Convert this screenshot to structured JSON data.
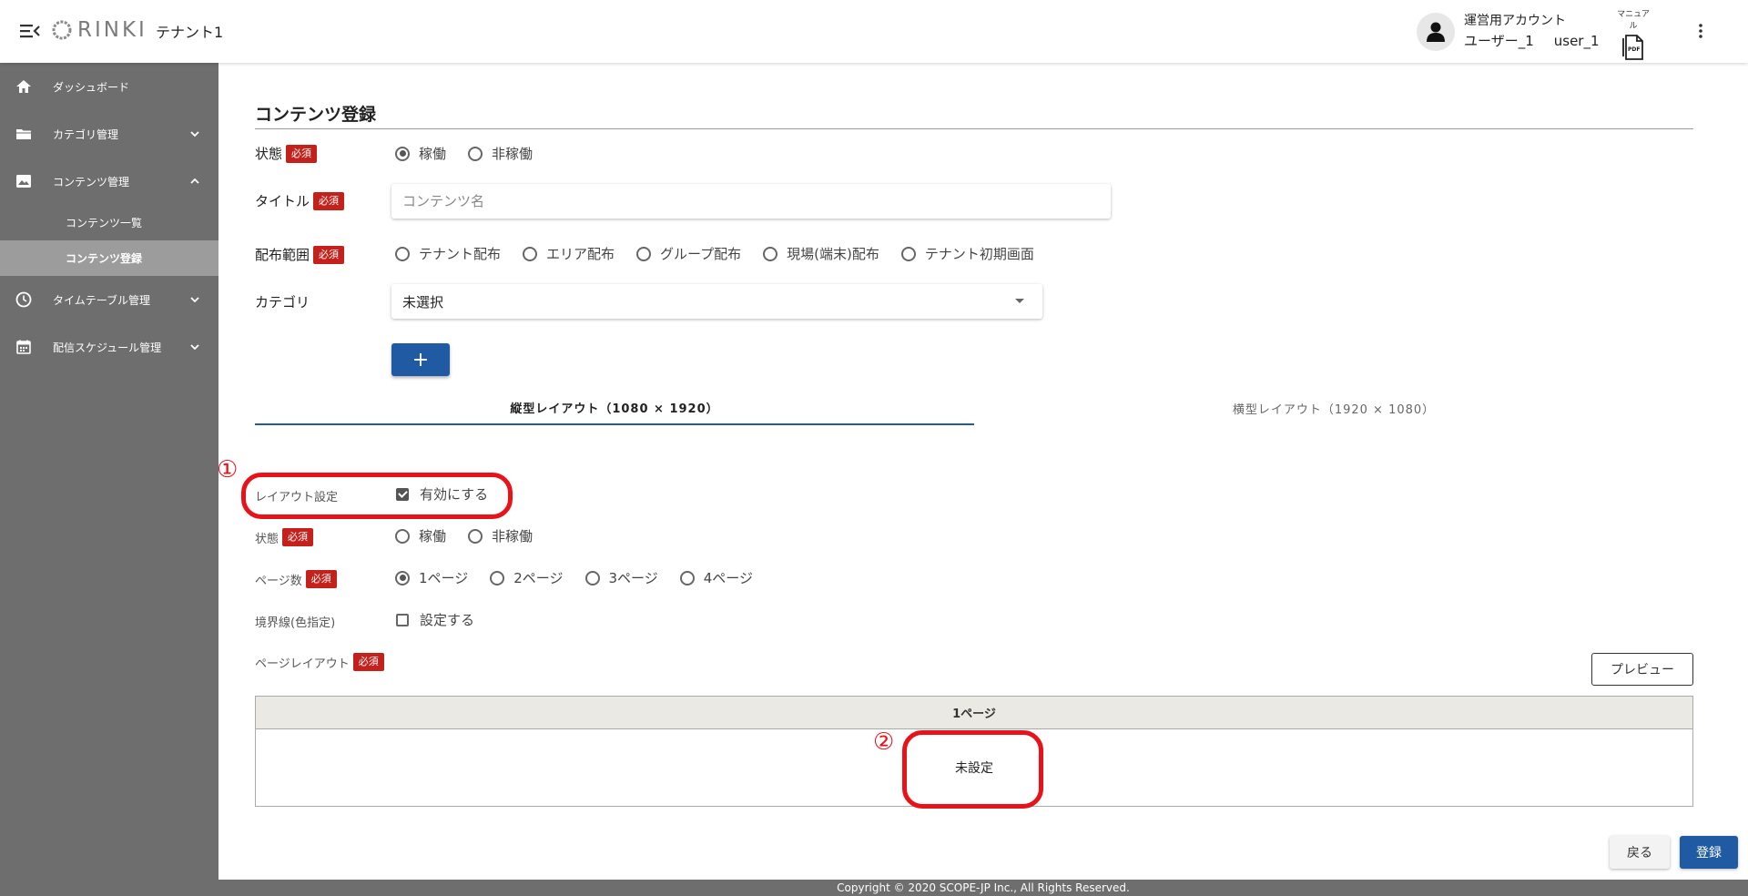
{
  "header": {
    "logo_text": "RINKI",
    "tenant": "テナント1",
    "account_type": "運営用アカウント",
    "user_name": "ユーザー_1",
    "user_id": "user_1",
    "manual_label": "マニュアル",
    "manual_pdf": "PDF"
  },
  "sidebar": {
    "items": [
      {
        "label": "ダッシュボード",
        "icon": "home-icon"
      },
      {
        "label": "カテゴリ管理",
        "icon": "folder-icon"
      },
      {
        "label": "コンテンツ管理",
        "icon": "image-icon"
      },
      {
        "label": "タイムテーブル管理",
        "icon": "clock-icon"
      },
      {
        "label": "配信スケジュール管理",
        "icon": "calendar-icon"
      }
    ],
    "sub_items": [
      {
        "label": "コンテンツ一覧"
      },
      {
        "label": "コンテンツ登録"
      }
    ]
  },
  "form": {
    "title": "コンテンツ登録",
    "required": "必須",
    "status_label": "状態",
    "status_options": [
      "稼働",
      "非稼働"
    ],
    "title_label": "タイトル",
    "title_placeholder": "コンテンツ名",
    "scope_label": "配布範囲",
    "scope_options": [
      "テナント配布",
      "エリア配布",
      "グループ配布",
      "現場(端末)配布",
      "テナント初期画面"
    ],
    "category_label": "カテゴリ",
    "category_value": "未選択",
    "add_label": "+"
  },
  "tabs": [
    {
      "label": "縦型レイアウト（1080 × 1920）"
    },
    {
      "label": "横型レイアウト（1920 × 1080）"
    }
  ],
  "layout": {
    "setting_label": "レイアウト設定",
    "enable_label": "有効にする",
    "status_label": "状態",
    "status_options": [
      "稼働",
      "非稼働"
    ],
    "pages_label": "ページ数",
    "pages_options": [
      "1ページ",
      "2ページ",
      "3ページ",
      "4ページ"
    ],
    "border_label": "境界線(色指定)",
    "border_option": "設定する",
    "page_layout_label": "ページレイアウト",
    "preview_label": "プレビュー",
    "table_header": "1ページ",
    "table_cell": "未設定"
  },
  "annotations": {
    "marker1": "①",
    "marker2": "②"
  },
  "actions": {
    "back": "戻る",
    "register": "登録"
  },
  "footer": {
    "copyright": "Copyright © 2020 SCOPE-JP Inc., All Rights Reserved."
  }
}
